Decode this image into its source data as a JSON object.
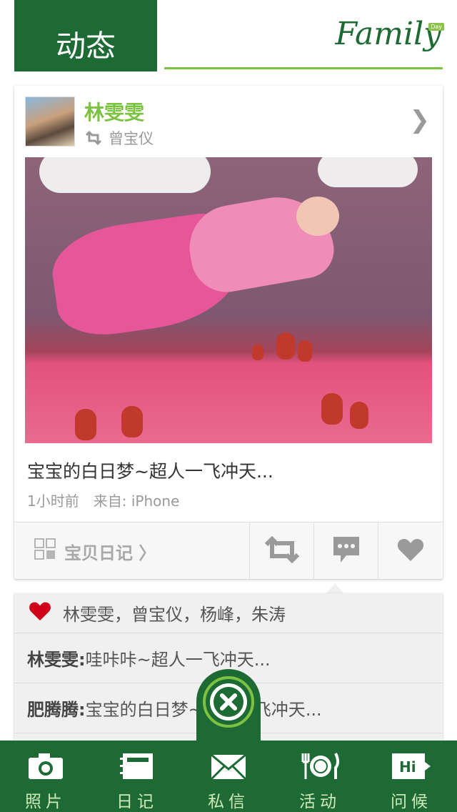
{
  "header": {
    "title": "动态",
    "logo": "Family",
    "logo_badge": "Day"
  },
  "post": {
    "author": "林雯雯",
    "reposted_by": "曾宝仪",
    "caption": "宝宝的白日梦~超人一飞冲天...",
    "time": "1小时前",
    "source": "来自: iPhone",
    "diary_label": "宝贝日记 〉"
  },
  "likes": {
    "names": "林雯雯，曾宝仪，杨峰，朱涛"
  },
  "comments": [
    {
      "author": "林雯雯:",
      "text": " 哇咔咔~超人一飞冲天..."
    },
    {
      "author": "肥腾腾:",
      "text": " 宝宝的白日梦~超人一飞冲天..."
    }
  ],
  "tabs": [
    {
      "label": "照片",
      "icon": "camera-icon"
    },
    {
      "label": "日记",
      "icon": "notebook-icon"
    },
    {
      "label": "私信",
      "icon": "envelope-icon"
    },
    {
      "label": "活动",
      "icon": "plate-cutlery-icon"
    },
    {
      "label": "问候",
      "icon": "hi-bubble-icon"
    }
  ],
  "colors": {
    "brand_green": "#1e6a35",
    "accent_green": "#7cc242",
    "like_red": "#d0021b"
  }
}
